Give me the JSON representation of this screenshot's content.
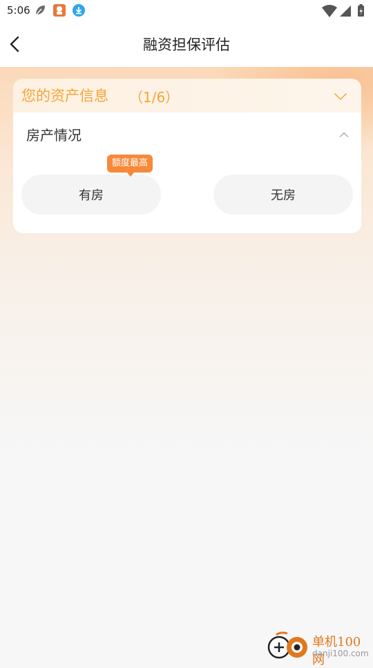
{
  "status_bar": {
    "time": "5:06",
    "icons": [
      "leaf-icon",
      "app-notification-icon",
      "download-icon",
      "wifi-icon",
      "signal-icon",
      "battery-icon"
    ]
  },
  "nav": {
    "title": "融资担保评估",
    "back_icon": "chevron-left-icon"
  },
  "card": {
    "header_title": "您的资产信息",
    "header_count": "（1/6）",
    "header_icon": "chevron-down-icon",
    "section_title": "房产情况",
    "section_icon": "chevron-up-icon",
    "options": [
      {
        "label": "有房",
        "badge": "额度最高"
      },
      {
        "label": "无房"
      }
    ]
  },
  "watermark": {
    "title": "单机100网",
    "url": "danji100.com"
  },
  "colors": {
    "accent": "#f6a43a",
    "badge": "#f7893a",
    "option_bg": "#f4f4f4"
  }
}
